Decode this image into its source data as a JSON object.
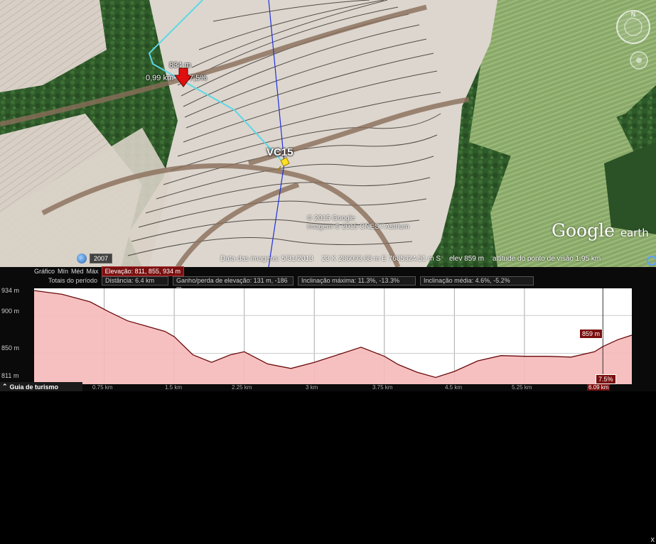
{
  "map": {
    "marker": {
      "elevation": "834 m",
      "distance": "0,99 km",
      "slope": "7,5%"
    },
    "placemark": {
      "label": "VC15"
    },
    "copyright": [
      "© 2015 Google",
      "Imagem © 2015 CNES / Astrium"
    ],
    "logo": {
      "main": "Google",
      "sub": "earth"
    },
    "year": "2007",
    "status": {
      "date": "Data das imagens: 5/31/2013",
      "coords": "23 K 286093.68 m E 7685324.51 m S",
      "elev": "elev  859 m",
      "eye": "altitude do ponto de visão  1.95 km"
    }
  },
  "panel": {
    "graph_label": "Gráfico",
    "stat_links": [
      "Mín",
      "Méd",
      "Máx"
    ],
    "elevation_box": "Elevação: 811, 855, 934 m",
    "totals_label": "Totais do período",
    "distance": "Distância: 6.4 km",
    "gain_loss": "Ganho/perda de elevação: 131 m, -186 m",
    "max_slope": "Inclinação máxima: 11.3%, -13.3%",
    "avg_slope": "Inclinação média: 4.6%, -5.2%",
    "cursor_elev": "859 m",
    "cursor_slope": "7.5%",
    "cursor_dist": "6.09 km",
    "tour_label": "Guia de turismo",
    "close_label": "x"
  },
  "chart_data": {
    "type": "area",
    "xlabel": "",
    "ylabel": "",
    "x_ticks": [
      "0.75 km",
      "1.5 km",
      "2.25 km",
      "3 km",
      "3.75 km",
      "4.5 km",
      "5.25 km",
      "6.09 km"
    ],
    "y_ticks": [
      "934 m",
      "900 m",
      "850 m",
      "811 m"
    ],
    "x_range": [
      0,
      6.4
    ],
    "y_range": [
      811,
      934
    ],
    "grid": true,
    "x": [
      0,
      0.3,
      0.6,
      0.8,
      1.0,
      1.2,
      1.4,
      1.5,
      1.7,
      1.9,
      2.1,
      2.25,
      2.5,
      2.75,
      3.0,
      3.25,
      3.5,
      3.75,
      3.9,
      4.1,
      4.3,
      4.5,
      4.75,
      5.0,
      5.25,
      5.5,
      5.75,
      6.0,
      6.09,
      6.25,
      6.4
    ],
    "y": [
      933,
      928,
      918,
      905,
      893,
      886,
      879,
      872,
      848,
      838,
      848,
      852,
      836,
      830,
      838,
      848,
      858,
      846,
      835,
      825,
      818,
      826,
      840,
      847,
      846,
      846,
      845,
      852,
      859,
      868,
      874
    ]
  }
}
